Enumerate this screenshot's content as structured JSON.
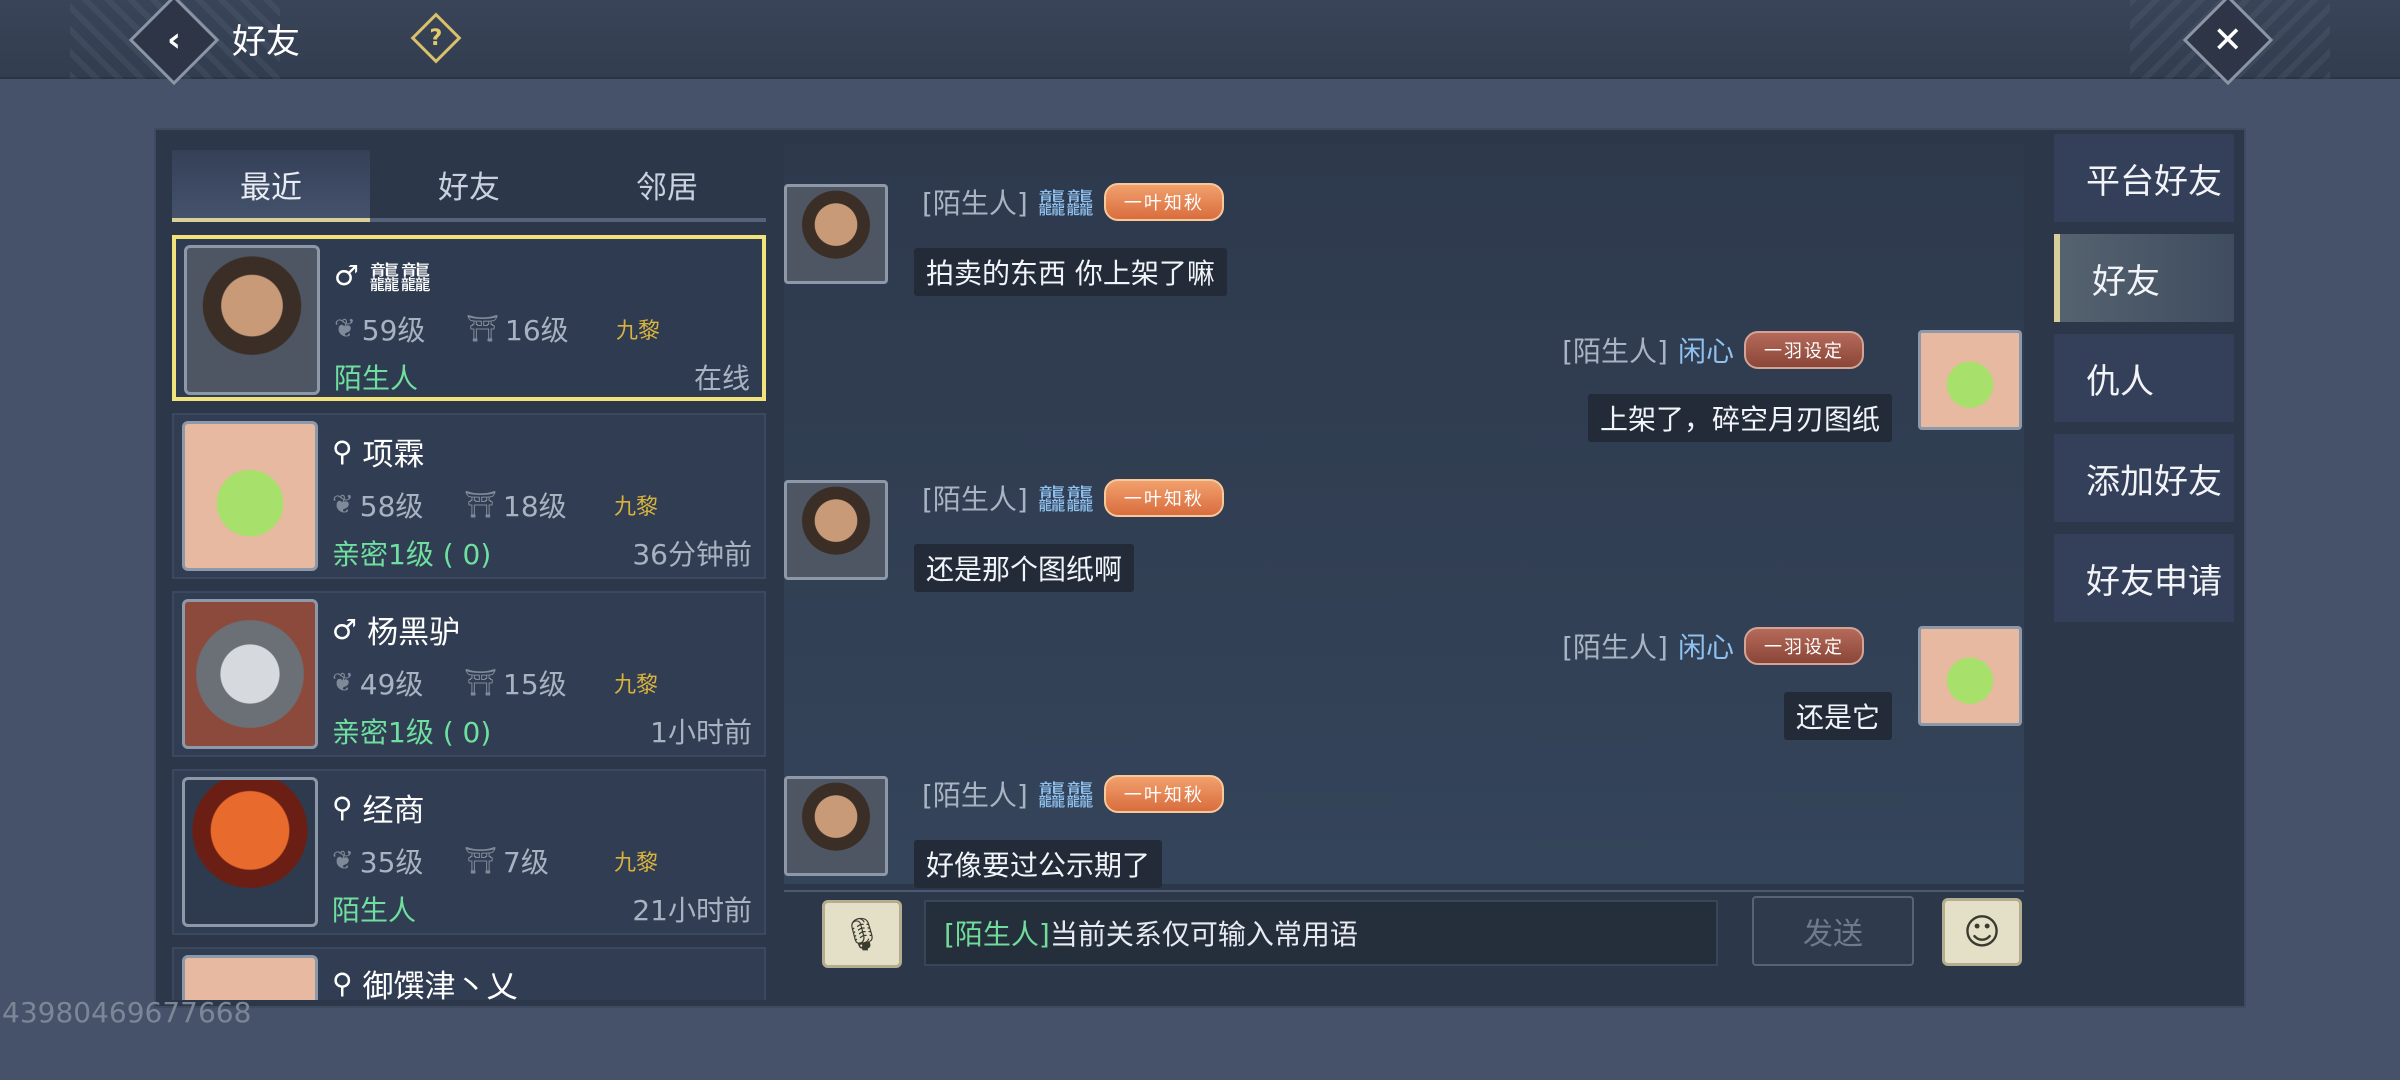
{
  "header": {
    "title": "好友",
    "back_icon": "chevron-left-icon",
    "help_label": "?",
    "close_label": "✕"
  },
  "tabs": [
    {
      "label": "最近",
      "active": true
    },
    {
      "label": "好友",
      "active": false
    },
    {
      "label": "邻居",
      "active": false
    }
  ],
  "friends": [
    {
      "gender": "♂",
      "name": "龘龘",
      "level": "59级",
      "sect_level": "16级",
      "guild": "九黎",
      "relation": "陌生人",
      "status": "在线",
      "selected": true
    },
    {
      "gender": "⚲",
      "name": "项霖",
      "level": "58级",
      "sect_level": "18级",
      "guild": "九黎",
      "relation": "亲密1级 ( 0)",
      "status": "36分钟前"
    },
    {
      "gender": "♂",
      "name": "杨黑驴",
      "level": "49级",
      "sect_level": "15级",
      "guild": "九黎",
      "relation": "亲密1级 ( 0)",
      "status": "1小时前"
    },
    {
      "gender": "⚲",
      "name": "经商",
      "level": "35级",
      "sect_level": "7级",
      "guild": "九黎",
      "relation": "陌生人",
      "status": "21小时前"
    },
    {
      "gender": "⚲",
      "name": "御馔津丶乂"
    }
  ],
  "chat": {
    "messages": [
      {
        "side": "left",
        "tag": "[陌生人]",
        "name": "龘龘",
        "badge": "一叶知秋",
        "text": "拍卖的东西 你上架了嘛"
      },
      {
        "side": "right",
        "tag": "[陌生人]",
        "name": "闲心",
        "badge": "一羽设定",
        "text": "上架了，碎空月刃图纸"
      },
      {
        "side": "left",
        "tag": "[陌生人]",
        "name": "龘龘",
        "badge": "一叶知秋",
        "text": "还是那个图纸啊"
      },
      {
        "side": "right",
        "tag": "[陌生人]",
        "name": "闲心",
        "badge": "一羽设定",
        "text": "还是它"
      },
      {
        "side": "left",
        "tag": "[陌生人]",
        "name": "龘龘",
        "badge": "一叶知秋",
        "text": "好像要过公示期了"
      }
    ],
    "input_tag": "[陌生人]",
    "input_text": "当前关系仅可输入常用语",
    "send_label": "发送"
  },
  "nav": [
    {
      "label": "平台好友",
      "active": false
    },
    {
      "label": "好友",
      "active": true
    },
    {
      "label": "仇人",
      "active": false
    },
    {
      "label": "添加好友",
      "active": false
    },
    {
      "label": "好友申请",
      "active": false
    }
  ],
  "user_id": "43980469677668",
  "colors": {
    "accent_gold": "#f2e27a",
    "relation_green": "#6fdfa0",
    "name_blue": "#8fc1ef"
  }
}
